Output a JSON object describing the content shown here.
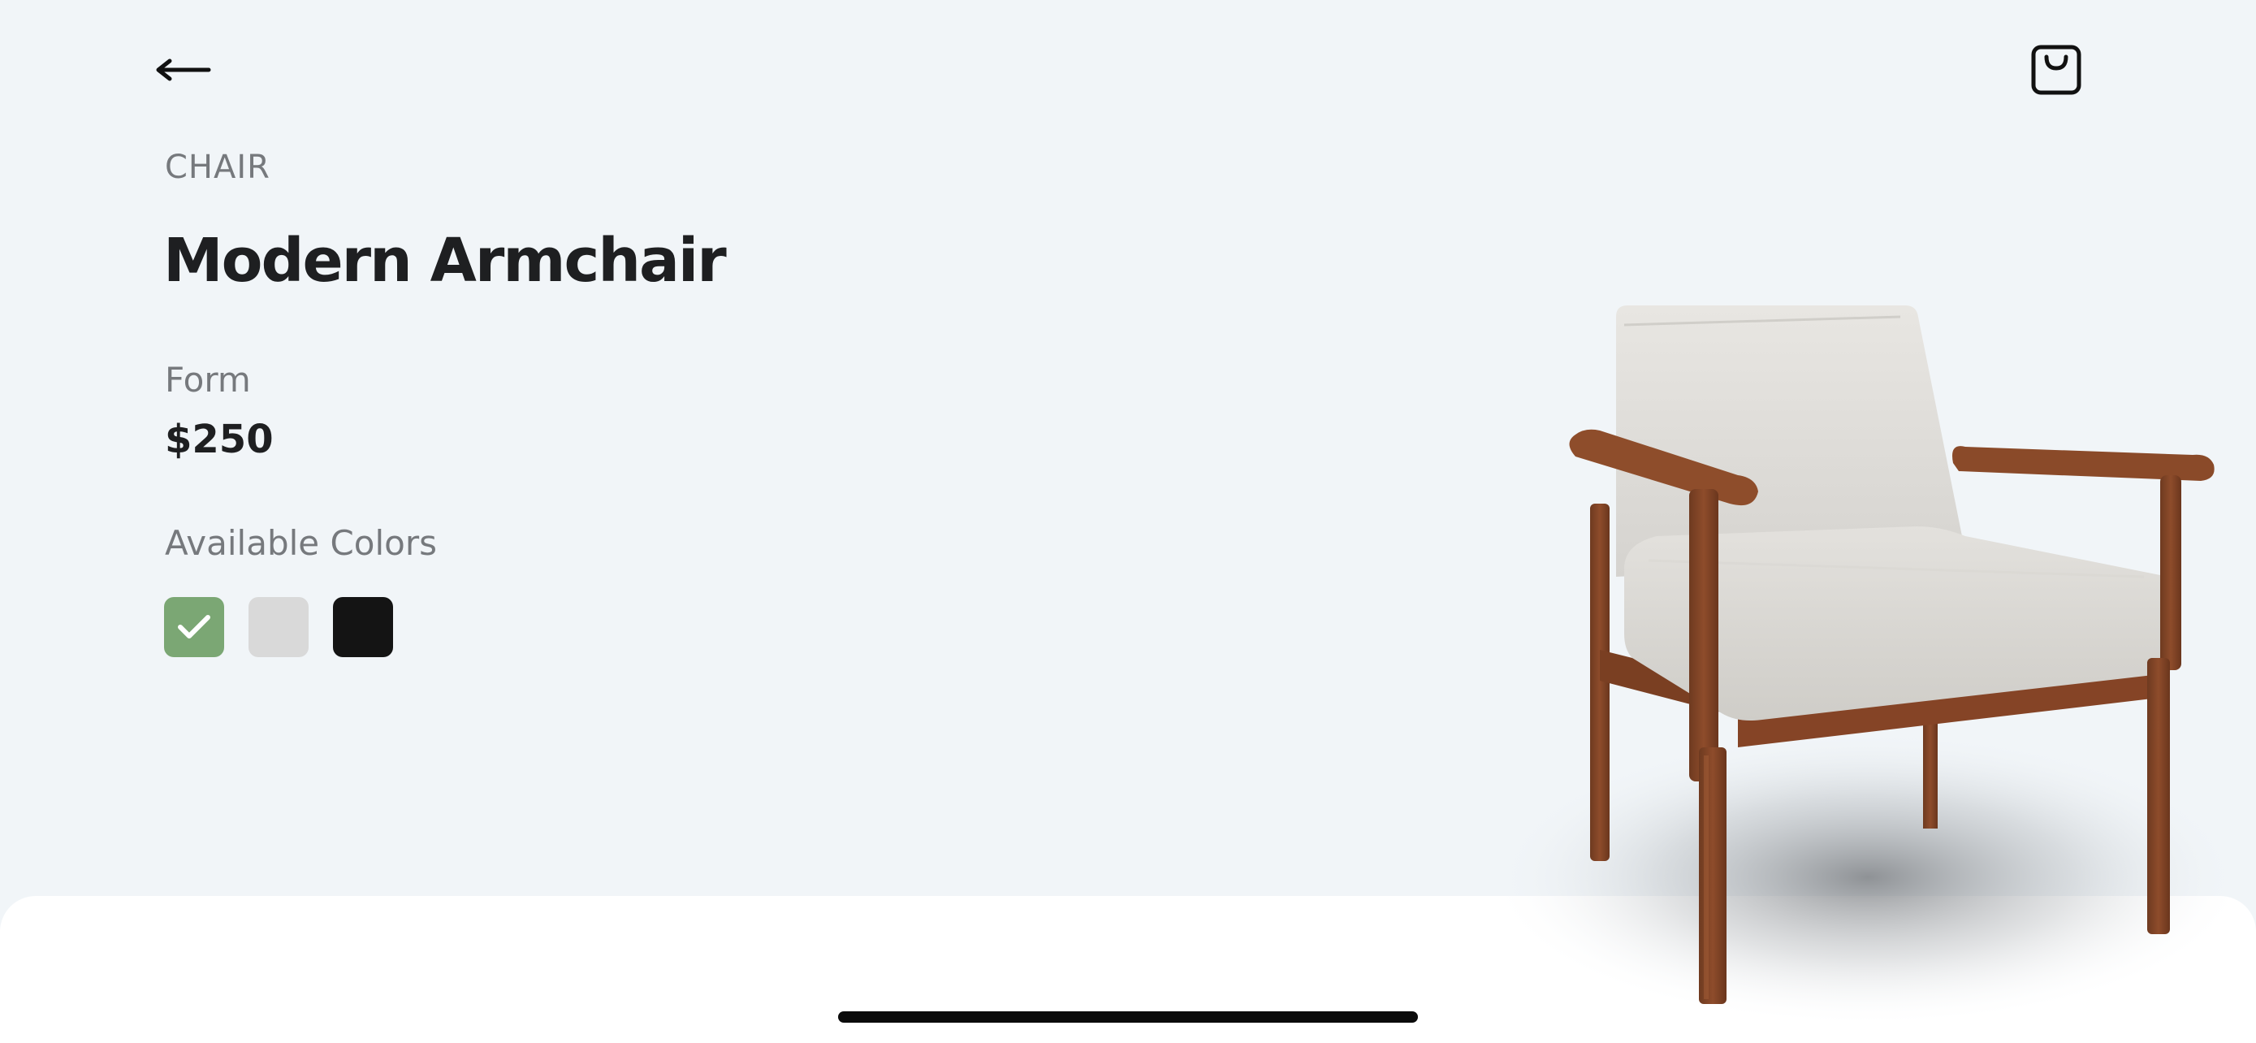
{
  "header": {
    "back_icon": "arrow-left-icon",
    "cart_icon": "shopping-bag-icon"
  },
  "product": {
    "category": "CHAIR",
    "title": "Modern Armchair",
    "brand": "Form",
    "price": "$250",
    "colors_label": "Available Colors",
    "colors": [
      {
        "name": "green",
        "hex": "#7ba774",
        "selected": true
      },
      {
        "name": "light-gray",
        "hex": "#d9d9d9",
        "selected": false
      },
      {
        "name": "black",
        "hex": "#141414",
        "selected": false
      }
    ],
    "image_icon": "armchair-image"
  }
}
